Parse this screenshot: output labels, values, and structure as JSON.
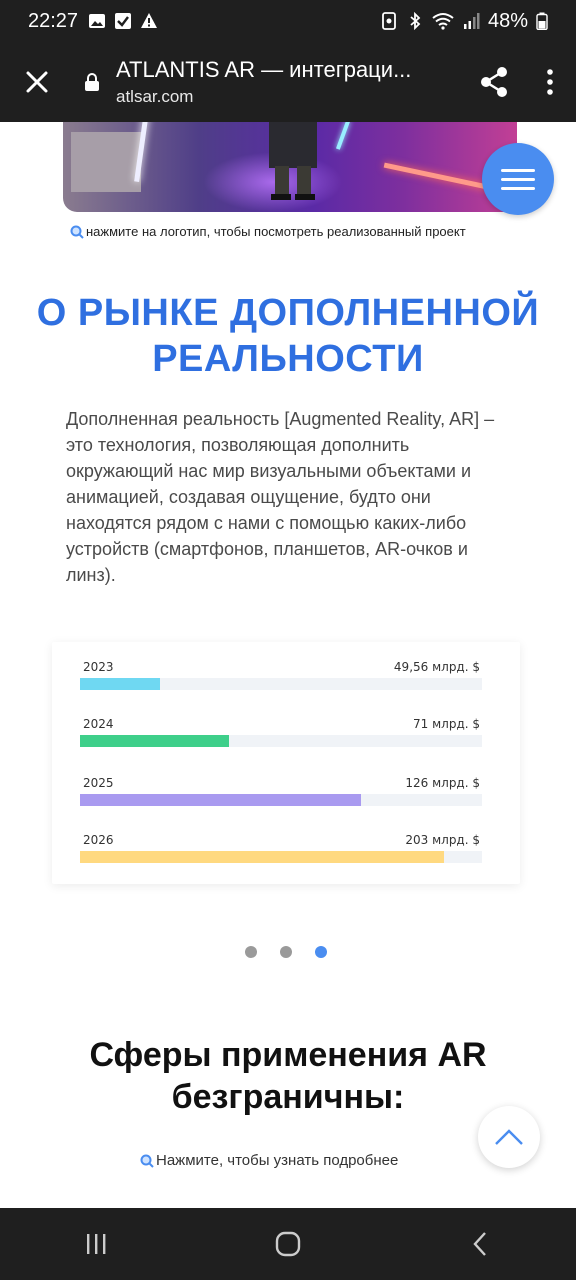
{
  "status": {
    "time": "22:27",
    "battery": "48%"
  },
  "browser": {
    "title": "ATLANTIS AR — интеграци...",
    "url": "atlsar.com"
  },
  "page": {
    "logo_hint": "нажмите на логотип, чтобы посмотреть реализованный проект",
    "heading": "О РЫНКЕ ДОПОЛНЕННОЙ РЕАЛЬНОСТИ",
    "paragraph": "Дополненная реальность [Augmented Reality, AR] – это технология, позволяющая дополнить окружающий нас мир визуальными объектами и анимацией, создавая ощущение, будто они находятся рядом с нами с помощью каких-либо устройств (смартфонов, планшетов, AR-очков и линз).",
    "section_title": "Сферы применения AR безграничны:",
    "details_hint": "Нажмите, чтобы узнать подробнее"
  },
  "chart_data": {
    "type": "bar",
    "orientation": "horizontal",
    "categories": [
      "2023",
      "2024",
      "2025",
      "2026"
    ],
    "labels": [
      "49,56 млрд. $",
      "71 млрд. $",
      "126 млрд. $",
      "203 млрд. $"
    ],
    "values": [
      49.56,
      71,
      126,
      203
    ],
    "colors": [
      "#6fd8f2",
      "#3ecf8a",
      "#a99af0",
      "#ffd980"
    ],
    "fill_fraction": [
      0.2,
      0.37,
      0.7,
      0.905
    ]
  },
  "carousel": {
    "total": 3,
    "active_index": 2
  },
  "icons": {
    "status": [
      "image-icon",
      "checkbox-icon",
      "warning-icon",
      "nfc-icon",
      "bluetooth-icon",
      "wifi-icon",
      "signal-icon",
      "battery-icon"
    ],
    "appbar": [
      "close-icon",
      "lock-icon",
      "share-icon",
      "more-vert-icon"
    ],
    "nav": [
      "recents-icon",
      "home-icon",
      "back-icon"
    ]
  },
  "colors": {
    "accent": "#2f6fe0",
    "fab": "#4a8df0",
    "chrome": "#1f1f1f"
  }
}
